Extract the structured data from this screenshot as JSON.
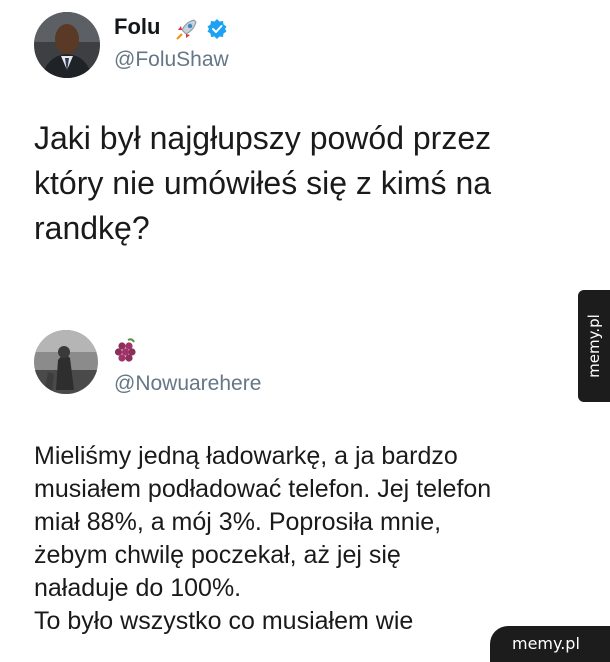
{
  "tweet1": {
    "display_name": "Folu",
    "handle": "@FoluShaw",
    "text_lines": [
      "Jaki był najgłupszy powód przez",
      "który nie umówiłeś się z kimś na",
      "randkę?"
    ],
    "icons": {
      "name_emoji": "rocket-icon",
      "badge": "verified-badge-icon"
    },
    "badge_color": "#1da1f2"
  },
  "tweet2": {
    "handle": "@Nowuarehere",
    "text_lines": [
      "Mieliśmy jedną ładowarkę, a ja bardzo",
      "musiałem podładować telefon. Jej telefon",
      "miał 88%, a mój 3%. Poprosiła mnie,",
      "żebym chwilę poczekał, aż jej się",
      "naładuje do 100%.",
      "To było wszystko co musiałem wie"
    ],
    "icons": {
      "name_emoji": "grapes-icon"
    }
  },
  "watermarks": {
    "side": "memy.pl",
    "corner": "memy.pl"
  },
  "colors": {
    "handle": "#657786",
    "text": "#1a1a1a",
    "watermark_bg": "#1c1c1c"
  }
}
